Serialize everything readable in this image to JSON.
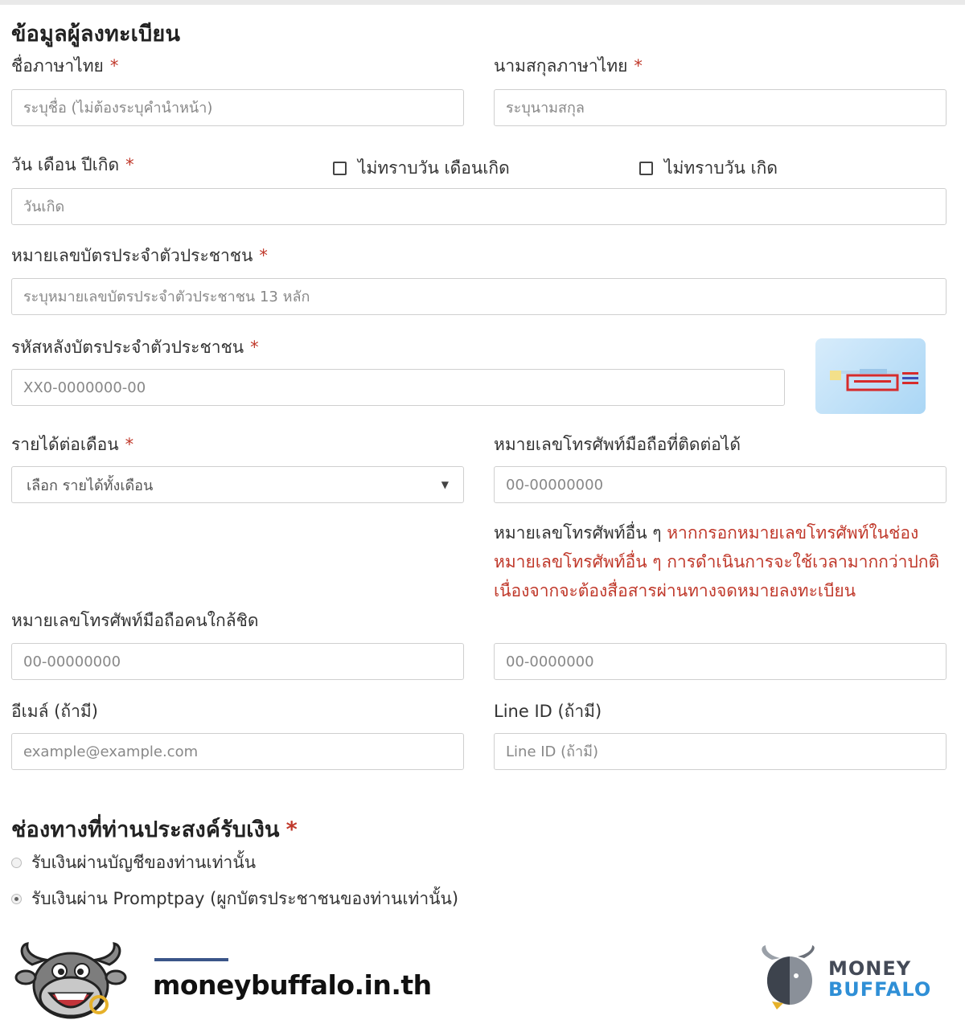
{
  "form": {
    "section_title": "ข้อมูลผู้ลงทะเบียน",
    "required_mark": "*",
    "first_name": {
      "label": "ชื่อภาษาไทย",
      "placeholder": "ระบุชื่อ (ไม่ต้องระบุคำนำหน้า)"
    },
    "last_name": {
      "label": "นามสกุลภาษาไทย",
      "placeholder": "ระบุนามสกุล"
    },
    "birthdate": {
      "label": "วัน เดือน ปีเกิด",
      "placeholder": "วันเกิด",
      "check_unknown_day_month": "ไม่ทราบวัน เดือนเกิด",
      "check_unknown_day": "ไม่ทราบวัน เกิด"
    },
    "id_number": {
      "label": "หมายเลขบัตรประจำตัวประชาชน",
      "placeholder": "ระบุหมายเลขบัตรประจำตัวประชาชน 13 หลัก"
    },
    "id_back_code": {
      "label": "รหัสหลังบัตรประจำตัวประชาชน",
      "placeholder": "XX0-0000000-00"
    },
    "income": {
      "label": "รายได้ต่อเดือน",
      "selected": "เลือก รายได้ทั้งเดือน",
      "caret": "▼"
    },
    "mobile": {
      "label": "หมายเลขโทรศัพท์มือถือที่ติดต่อได้",
      "placeholder": "00-00000000"
    },
    "other_phone": {
      "label": "หมายเลขโทรศัพท์อื่น ๆ",
      "note": "หากกรอกหมายเลขโทรศัพท์ในช่อง หมายเลขโทรศัพท์อื่น ๆ การดำเนินการจะใช้เวลามากกว่าปกติ เนื่องจากจะต้องสื่อสารผ่านทางจดหมายลงทะเบียน",
      "placeholder": "00-0000000"
    },
    "close_contact": {
      "label": "หมายเลขโทรศัพท์มือถือคนใกล้ชิด",
      "placeholder": "00-00000000"
    },
    "email": {
      "label": "อีเมล์ (ถ้ามี)",
      "placeholder": "example@example.com"
    },
    "line_id": {
      "label": "Line ID (ถ้ามี)",
      "placeholder": "Line ID (ถ้ามี)"
    }
  },
  "payment": {
    "title": "ช่องทางที่ท่านประสงค์รับเงิน",
    "options": [
      {
        "label": "รับเงินผ่านบัญชีของท่านเท่านั้น",
        "checked": false
      },
      {
        "label": "รับเงินผ่าน Promptpay (ผูกบัตรประชาชนของท่านเท่านั้น)",
        "checked": true
      }
    ]
  },
  "footer": {
    "url": "moneybuffalo.in.th",
    "brand_line1": "MONEY",
    "brand_line2": "BUFFALO"
  },
  "colors": {
    "required": "#c0392b",
    "brand_blue": "#2f8fd6",
    "brand_dark": "#444a57"
  }
}
